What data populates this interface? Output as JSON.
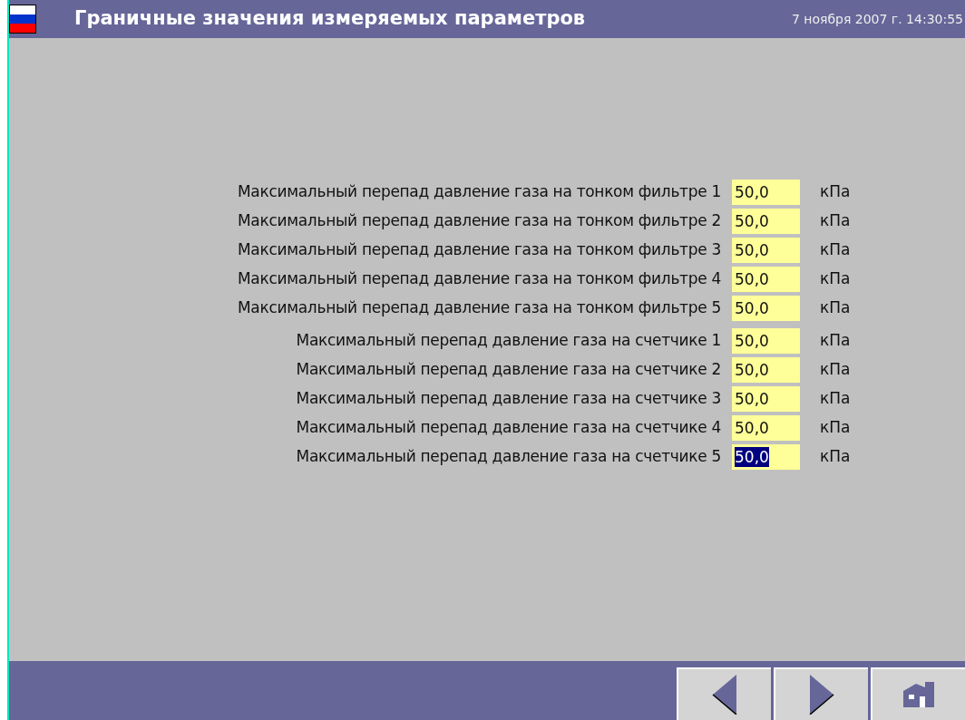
{
  "header": {
    "title": "Граничные значения измеряемых параметров",
    "datetime": "7 ноября 2007 г. 14:30:55"
  },
  "groups": [
    {
      "rows": [
        {
          "label": "Максимальный перепад давление газа на тонком фильтре 1",
          "value": "50,0",
          "unit": "кПа",
          "selected": false
        },
        {
          "label": "Максимальный перепад давление газа на тонком фильтре 2",
          "value": "50,0",
          "unit": "кПа",
          "selected": false
        },
        {
          "label": "Максимальный перепад давление газа на тонком фильтре 3",
          "value": "50,0",
          "unit": "кПа",
          "selected": false
        },
        {
          "label": "Максимальный перепад давление газа на тонком фильтре 4",
          "value": "50,0",
          "unit": "кПа",
          "selected": false
        },
        {
          "label": "Максимальный перепад давление газа на тонком фильтре 5",
          "value": "50,0",
          "unit": "кПа",
          "selected": false
        }
      ]
    },
    {
      "rows": [
        {
          "label": "Максимальный перепад давление газа на счетчике 1",
          "value": "50,0",
          "unit": "кПа",
          "selected": false
        },
        {
          "label": "Максимальный перепад давление газа на счетчике 2",
          "value": "50,0",
          "unit": "кПа",
          "selected": false
        },
        {
          "label": "Максимальный перепад давление газа на счетчике 3",
          "value": "50,0",
          "unit": "кПа",
          "selected": false
        },
        {
          "label": "Максимальный перепад давление газа на счетчике 4",
          "value": "50,0",
          "unit": "кПа",
          "selected": false
        },
        {
          "label": "Максимальный перепад давление газа на счетчике 5",
          "value": "50,0",
          "unit": "кПа",
          "selected": true
        }
      ]
    }
  ],
  "nav_buttons": [
    {
      "kind": "back"
    },
    {
      "kind": "forward"
    },
    {
      "kind": "home"
    }
  ]
}
